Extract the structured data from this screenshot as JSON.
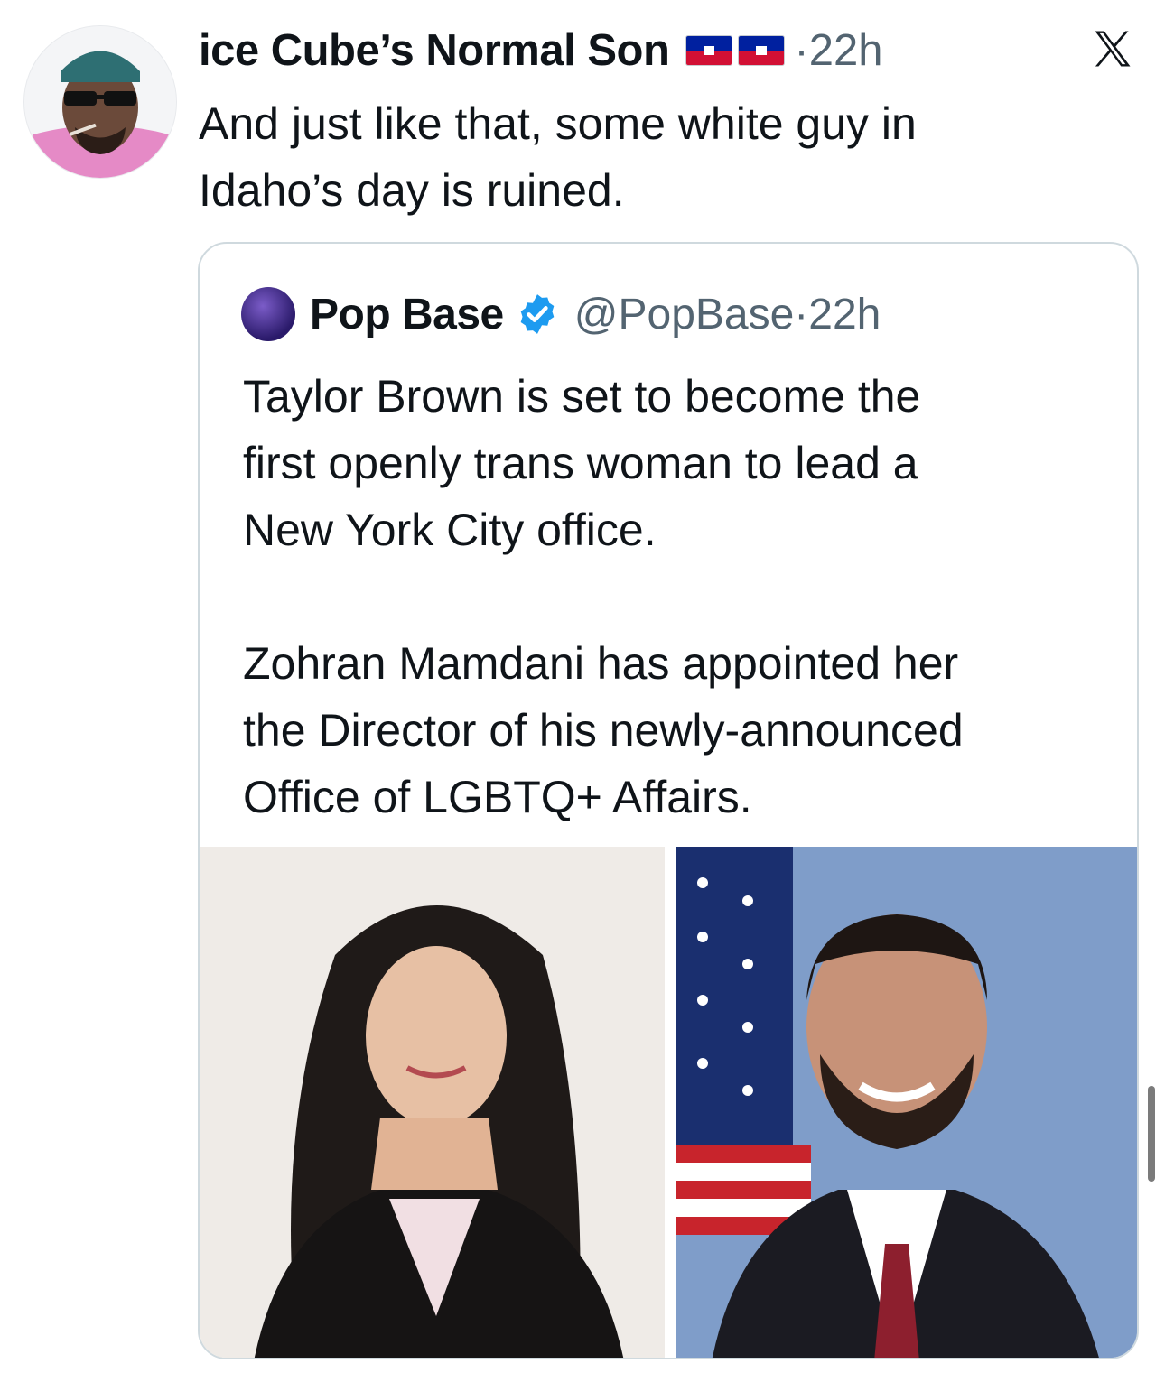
{
  "post": {
    "author_name": "ice Cube’s Normal Son",
    "time": "·22h",
    "text_lines": [
      "And just like that, some white guy in",
      "Idaho’s day is ruined."
    ]
  },
  "quote": {
    "author_name": "Pop Base",
    "handle": "@PopBase",
    "time": "·22h",
    "text_lines": [
      "Taylor Brown is set to become the",
      "first openly trans woman to lead a",
      "New York City office.",
      "",
      "Zohran Mamdani has appointed her",
      "the Director of his newly-announced",
      "Office of LGBTQ+ Affairs."
    ]
  },
  "icons": {
    "x_logo": "x-logo-icon",
    "verified": "verified-badge-icon",
    "flags": [
      "haiti-flag-icon",
      "haiti-flag-icon"
    ]
  },
  "colors": {
    "muted_text": "#536471",
    "verified_blue": "#1d9bf0",
    "border": "#cfd9de"
  }
}
